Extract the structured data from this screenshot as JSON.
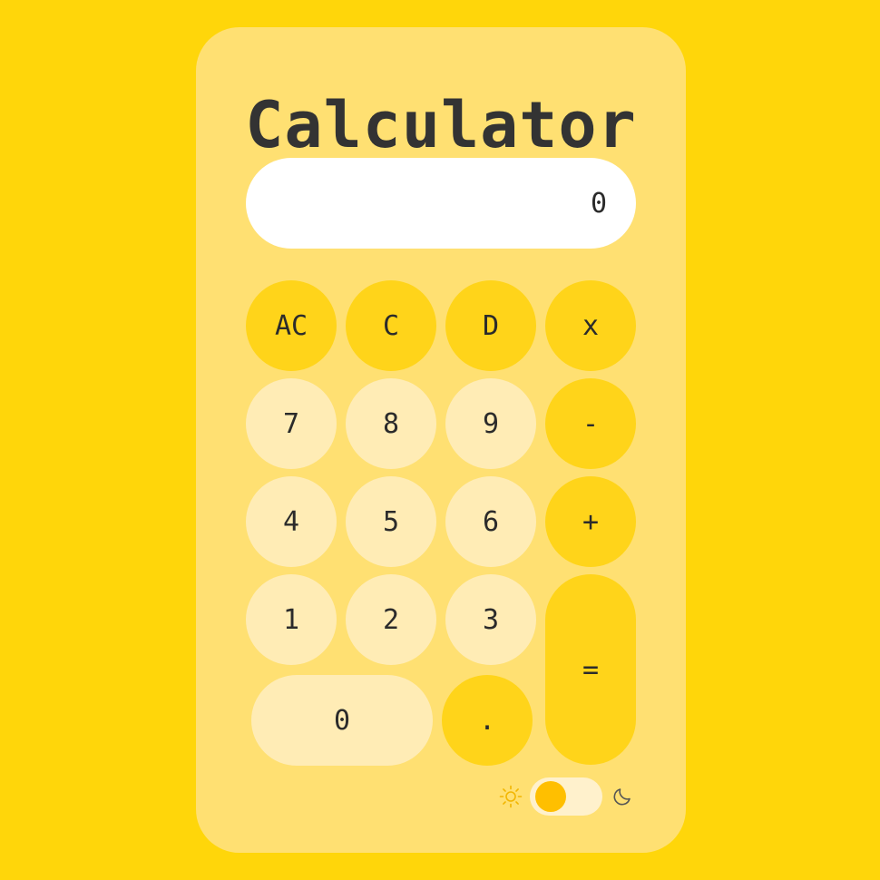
{
  "app": {
    "title": "Calculator"
  },
  "display": {
    "value": "0"
  },
  "keys": {
    "ac": "AC",
    "c": "C",
    "d": "D",
    "multiply": "x",
    "seven": "7",
    "eight": "8",
    "nine": "9",
    "minus": "-",
    "four": "4",
    "five": "5",
    "six": "6",
    "plus": "+",
    "one": "1",
    "two": "2",
    "three": "3",
    "equals": "=",
    "zero": "0",
    "decimal": "."
  },
  "theme": {
    "icons": [
      "sun-icon",
      "moon-icon"
    ],
    "mode": "light",
    "colors": {
      "background": "#FFD60A",
      "card": "#FFE072",
      "operator_key": "#FFD41A",
      "number_key": "#FFECB5",
      "display": "#FFFFFF",
      "toggle_knob": "#FFBF00",
      "text": "#2B2B2B"
    }
  }
}
